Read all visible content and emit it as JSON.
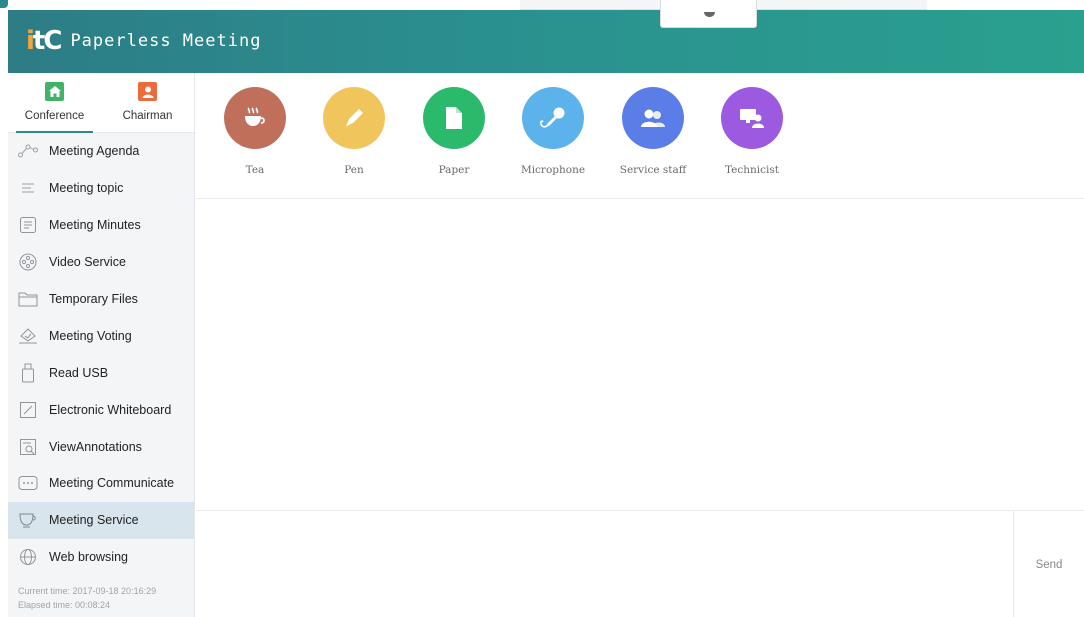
{
  "app": {
    "logo_text": "itC",
    "title": "Paperless Meeting"
  },
  "roles": [
    {
      "label": "Conference",
      "icon": "home-icon",
      "color": "#3fb469",
      "active": true
    },
    {
      "label": "Chairman",
      "icon": "person-icon",
      "color": "#ef6a3a",
      "active": false
    }
  ],
  "menu": [
    {
      "label": "Meeting Agenda",
      "icon": "agenda-icon"
    },
    {
      "label": "Meeting topic",
      "icon": "list-icon"
    },
    {
      "label": "Meeting Minutes",
      "icon": "minutes-icon"
    },
    {
      "label": "Video Service",
      "icon": "film-reel-icon"
    },
    {
      "label": "Temporary Files",
      "icon": "folder-icon"
    },
    {
      "label": "Meeting Voting",
      "icon": "vote-icon"
    },
    {
      "label": "Read USB",
      "icon": "usb-icon"
    },
    {
      "label": "Electronic Whiteboard",
      "icon": "whiteboard-icon"
    },
    {
      "label": "ViewAnnotations",
      "icon": "annotation-icon"
    },
    {
      "label": "Meeting Communicate",
      "icon": "chat-icon"
    },
    {
      "label": "Meeting Service",
      "icon": "cup-icon",
      "active": true
    },
    {
      "label": "Web browsing",
      "icon": "globe-icon"
    }
  ],
  "status": {
    "current_time": "Current time: 2017-09-18 20:16:29",
    "elapsed_time": "Elapsed time: 00:08:24"
  },
  "services": [
    {
      "label": "Tea",
      "icon": "tea-cup-icon",
      "color": "#c0705a"
    },
    {
      "label": "Pen",
      "icon": "pen-icon",
      "color": "#f0c65c"
    },
    {
      "label": "Paper",
      "icon": "paper-icon",
      "color": "#2bb96b"
    },
    {
      "label": "Microphone",
      "icon": "microphone-icon",
      "color": "#5cb3ec"
    },
    {
      "label": "Service staff",
      "icon": "staff-icon",
      "color": "#5b7de8"
    },
    {
      "label": "Technicist",
      "icon": "technician-icon",
      "color": "#9b5ae0"
    }
  ],
  "compose": {
    "send_label": "Send"
  },
  "colors": {
    "accent": "#2a8a8c",
    "active_menu_bg": "#d8e5ec"
  }
}
